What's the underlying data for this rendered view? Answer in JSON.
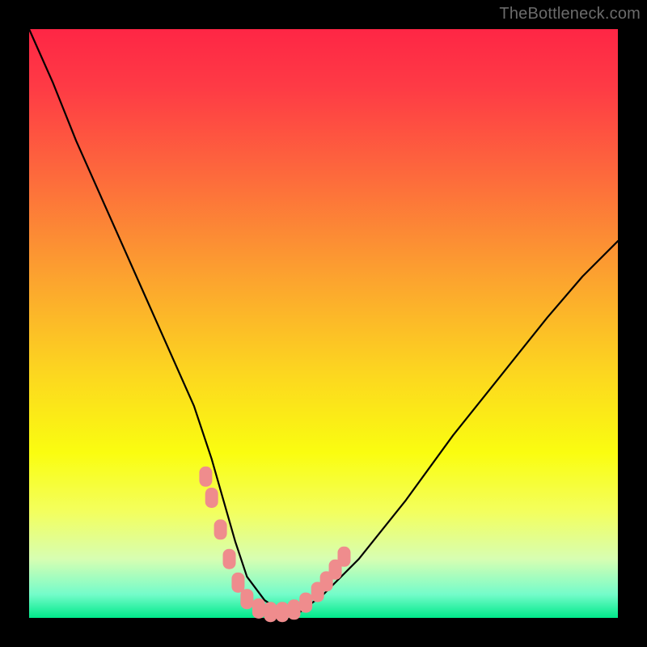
{
  "watermark": {
    "text": "TheBottleneck.com"
  },
  "colors": {
    "background": "#000000",
    "curve_stroke": "#000000",
    "marker_fill": "#ef8c8d",
    "marker_stroke": "#ef8c8d"
  },
  "chart_data": {
    "type": "line",
    "title": "",
    "xlabel": "",
    "ylabel": "",
    "xlim": [
      0,
      100
    ],
    "ylim": [
      0,
      100
    ],
    "grid": false,
    "legend": false,
    "series": [
      {
        "name": "curve",
        "x": [
          0,
          4,
          8,
          12,
          16,
          20,
          24,
          28,
          31,
          33,
          35,
          37,
          40,
          43,
          46,
          50,
          56,
          64,
          72,
          80,
          88,
          94,
          100
        ],
        "y": [
          100,
          91,
          81,
          72,
          63,
          54,
          45,
          36,
          27,
          20,
          13,
          7,
          3,
          1,
          1,
          4,
          10,
          20,
          31,
          41,
          51,
          58,
          64
        ]
      }
    ],
    "markers": {
      "note": "Highlighted points near the valley (pink rounded markers)",
      "points": [
        {
          "x": 30.0,
          "y": 24.0
        },
        {
          "x": 31.0,
          "y": 20.4
        },
        {
          "x": 32.5,
          "y": 15.0
        },
        {
          "x": 34.0,
          "y": 10.0
        },
        {
          "x": 35.5,
          "y": 6.0
        },
        {
          "x": 37.0,
          "y": 3.2
        },
        {
          "x": 39.0,
          "y": 1.6
        },
        {
          "x": 41.0,
          "y": 1.0
        },
        {
          "x": 43.0,
          "y": 1.0
        },
        {
          "x": 45.0,
          "y": 1.4
        },
        {
          "x": 47.0,
          "y": 2.6
        },
        {
          "x": 49.0,
          "y": 4.4
        },
        {
          "x": 50.5,
          "y": 6.2
        },
        {
          "x": 52.0,
          "y": 8.2
        },
        {
          "x": 53.5,
          "y": 10.4
        }
      ]
    }
  }
}
